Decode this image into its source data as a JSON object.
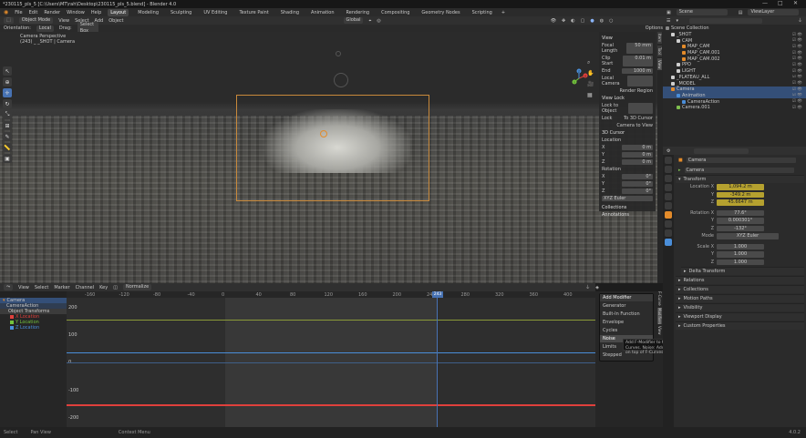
{
  "titlebar": {
    "title": "*230115_pls_5 [C:\\Users\\MT\\rah\\Desktop\\230115_pls_5.blend] - Blender 4.0",
    "minimize": "—",
    "maximize": "□",
    "close": "✕"
  },
  "menubar": {
    "items": [
      "File",
      "Edit",
      "Render",
      "Window",
      "Help"
    ],
    "workspaces": [
      "Layout",
      "Modeling",
      "Sculpting",
      "UV Editing",
      "Texture Paint",
      "Shading",
      "Animation",
      "Rendering",
      "Compositing",
      "Geometry Nodes",
      "Scripting"
    ],
    "add_tab": "+"
  },
  "viewport": {
    "header": {
      "mode": "Object Mode",
      "menus": [
        "View",
        "Select",
        "Add",
        "Object"
      ],
      "orientation": "Global"
    },
    "subheader": {
      "orientation_label": "Orientation:",
      "orientation": "Local",
      "drag_label": "Drag:",
      "drag": "Select Box",
      "options": "Options"
    },
    "overlay_text": {
      "line1": "Camera Perspective",
      "line2": "(243) _ _SHOT | Camera"
    },
    "gizmo": {
      "x": "X",
      "y": "Y",
      "z": "Z"
    },
    "npanel": {
      "view_header": "View",
      "focal_label": "Focal Length",
      "focal": "50 mm",
      "clip_start_label": "Clip Start",
      "clip_start": "0.01 m",
      "end_label": "End",
      "end": "1000 m",
      "local_camera_label": "Local Camera",
      "render_region": "Render Region",
      "view_lock_header": "View Lock",
      "lock_to_object_label": "Lock to Object",
      "lock_label": "Lock",
      "lock_to_3d_cursor": "To 3D Cursor",
      "camera_to_view": "Camera to View",
      "cursor_header": "3D Cursor",
      "location_label": "Location",
      "x": "0 m",
      "y": "0 m",
      "z": "0 m",
      "rotation_label": "Rotation",
      "rx": "0°",
      "ry": "0°",
      "rz": "0°",
      "mode": "XYZ Euler",
      "collections": "Collections",
      "annotations": "Annotations"
    },
    "ntabs": [
      "Item",
      "Tool",
      "View"
    ]
  },
  "graph": {
    "header": {
      "menus": [
        "View",
        "Select",
        "Marker",
        "Channel",
        "Key"
      ],
      "mode": "Normalize"
    },
    "ruler": [
      "-160",
      "-120",
      "-80",
      "-40",
      "0",
      "40",
      "80",
      "120",
      "160",
      "200",
      "240",
      "280",
      "320",
      "360",
      "400"
    ],
    "yticks": [
      "200",
      "100",
      "0",
      "-100",
      "-200"
    ],
    "current_frame": "243",
    "channels": [
      {
        "label": "Camera"
      },
      {
        "label": "CameraAction"
      },
      {
        "label": "Object Transforms"
      },
      {
        "label": "X Location",
        "color": "#e0403c"
      },
      {
        "label": "Y Location",
        "color": "#73c33d"
      },
      {
        "label": "Z Location",
        "color": "#4a8ed9"
      }
    ],
    "curves": [
      {
        "name": "X Location",
        "color": "#e0403c"
      },
      {
        "name": "Y Location",
        "color": "#8a9a38"
      },
      {
        "name": "Z Location",
        "color": "#4a8ed9"
      }
    ],
    "fpanel_tabs": [
      "F-Curve",
      "Modifiers",
      "View"
    ]
  },
  "addmod_menu": {
    "header": "Add Modifier",
    "items": [
      "Generator",
      "Built-In Function",
      "Envelope",
      "Cycles",
      "Noise",
      "Limits",
      "Stepped"
    ],
    "highlight": "Noise"
  },
  "tooltip": "Add F-Modifier to the active/selected F-Curves. Noise: Add pseudo-random noise on top of F-Curves",
  "status": {
    "items": [
      "Select",
      "Pan View",
      "Context Menu"
    ],
    "version": "4.0.2"
  },
  "right_header": {
    "scene_label": "Scene",
    "view_layer_label": "ViewLayer"
  },
  "outliner": {
    "search_placeholder": "",
    "rows": [
      {
        "label": "Scene Collection",
        "indent": 0,
        "color": "#888"
      },
      {
        "label": "_SHOT",
        "indent": 1,
        "color": "#cfcfcf"
      },
      {
        "label": "CAM",
        "indent": 2,
        "color": "#cfcfcf"
      },
      {
        "label": "MAP_CAM",
        "indent": 3,
        "color": "#e38b2a"
      },
      {
        "label": "MAP_CAM.001",
        "indent": 3,
        "color": "#e38b2a"
      },
      {
        "label": "MAP_CAM.002",
        "indent": 3,
        "color": "#e38b2a"
      },
      {
        "label": "PPO",
        "indent": 2,
        "color": "#cfcfcf"
      },
      {
        "label": "LIGHT",
        "indent": 2,
        "color": "#cfcfcf"
      },
      {
        "label": "_PLATEAU_ALL",
        "indent": 1,
        "color": "#cfcfcf"
      },
      {
        "label": "_MODEL",
        "indent": 1,
        "color": "#cfcfcf"
      },
      {
        "label": "Camera",
        "indent": 1,
        "color": "#e38b2a",
        "selected": true
      },
      {
        "label": "Animation",
        "indent": 2,
        "color": "#4a8ed9",
        "selected": true
      },
      {
        "label": "CameraAction",
        "indent": 3,
        "color": "#4a8ed9"
      },
      {
        "label": "Camera.001",
        "indent": 2,
        "color": "#7fbf4f"
      }
    ]
  },
  "properties": {
    "object_name": "Camera",
    "datablock": "Camera",
    "transform_header": "Transform",
    "location_label": "Location X",
    "y_label": "Y",
    "z_label": "Z",
    "loc_x": "1,094.2 m",
    "loc_y": "-349.2 m",
    "loc_z": "45.6647 m",
    "rotation_label": "Rotation X",
    "rot_x": "77.6°",
    "rot_y": "0.000301°",
    "rot_z": "-132°",
    "mode_label": "Mode",
    "mode": "XYZ Euler",
    "scale_label": "Scale X",
    "scale_x": "1.000",
    "scale_y": "1.000",
    "scale_z": "1.000",
    "sections": [
      "Delta Transform",
      "Relations",
      "Collections",
      "Motion Paths",
      "Visibility",
      "Viewport Display",
      "Custom Properties"
    ]
  }
}
